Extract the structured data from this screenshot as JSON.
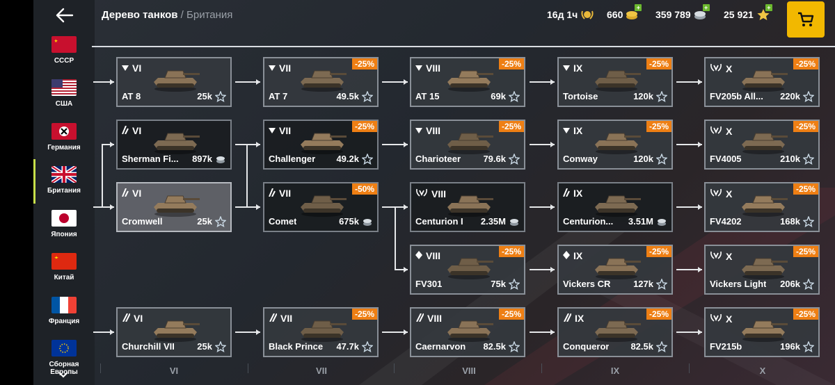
{
  "header": {
    "title": "Дерево танков",
    "separator": " / ",
    "subtitle": "Британия",
    "premium_time": "16д 1ч",
    "gold": "660",
    "credits": "359 789",
    "free_xp": "25 921"
  },
  "nations": [
    {
      "label": "СССР",
      "icon": "ussr-flag-icon"
    },
    {
      "label": "США",
      "icon": "usa-flag-icon"
    },
    {
      "label": "Германия",
      "icon": "germany-flag-icon"
    },
    {
      "label": "Британия",
      "icon": "uk-flag-icon",
      "active": true
    },
    {
      "label": "Япония",
      "icon": "japan-flag-icon"
    },
    {
      "label": "Китай",
      "icon": "china-flag-icon"
    },
    {
      "label": "Франция",
      "icon": "france-flag-icon"
    },
    {
      "label": "Сборная Европы",
      "icon": "europe-flag-icon"
    }
  ],
  "tanks": [
    {
      "tier": "VI",
      "name": "AT 8",
      "price": "25k",
      "currency": "star",
      "type": "td",
      "discount": ""
    },
    {
      "tier": "VII",
      "name": "AT 7",
      "price": "49.5k",
      "currency": "star",
      "type": "td",
      "discount": "-25%"
    },
    {
      "tier": "VIII",
      "name": "AT 15",
      "price": "69k",
      "currency": "star",
      "type": "td",
      "discount": "-25%"
    },
    {
      "tier": "IX",
      "name": "Tortoise",
      "price": "120k",
      "currency": "star",
      "type": "td",
      "discount": "-25%"
    },
    {
      "tier": "X",
      "name": "FV205b All...",
      "price": "220k",
      "currency": "star",
      "type": "elite-td",
      "discount": "-25%"
    },
    {
      "tier": "VI",
      "name": "Sherman Fi...",
      "price": "897k",
      "currency": "credits",
      "type": "medium",
      "discount": ""
    },
    {
      "tier": "VII",
      "name": "Challenger",
      "price": "49.2k",
      "currency": "star",
      "type": "td",
      "discount": "-25%"
    },
    {
      "tier": "VIII",
      "name": "Charioteer",
      "price": "79.6k",
      "currency": "star",
      "type": "td",
      "discount": "-25%"
    },
    {
      "tier": "IX",
      "name": "Conway",
      "price": "120k",
      "currency": "star",
      "type": "td",
      "discount": "-25%"
    },
    {
      "tier": "X",
      "name": "FV4005",
      "price": "210k",
      "currency": "star",
      "type": "elite-td",
      "discount": "-25%"
    },
    {
      "tier": "VI",
      "name": "Cromwell",
      "price": "25k",
      "currency": "star",
      "type": "medium",
      "discount": ""
    },
    {
      "tier": "VII",
      "name": "Comet",
      "price": "675k",
      "currency": "credits",
      "type": "medium",
      "discount": "-50%"
    },
    {
      "tier": "VIII",
      "name": "Centurion I",
      "price": "2.35M",
      "currency": "credits",
      "type": "elite-medium",
      "discount": ""
    },
    {
      "tier": "IX",
      "name": "Centurion...",
      "price": "3.51M",
      "currency": "credits",
      "type": "medium",
      "discount": ""
    },
    {
      "tier": "X",
      "name": "FV4202",
      "price": "168k",
      "currency": "star",
      "type": "elite-medium",
      "discount": "-25%"
    },
    {
      "tier": "VIII",
      "name": "FV301",
      "price": "75k",
      "currency": "star",
      "type": "light",
      "discount": "-25%"
    },
    {
      "tier": "IX",
      "name": "Vickers CR",
      "price": "127k",
      "currency": "star",
      "type": "light",
      "discount": "-25%"
    },
    {
      "tier": "X",
      "name": "Vickers Light",
      "price": "206k",
      "currency": "star",
      "type": "elite-light",
      "discount": "-25%"
    },
    {
      "tier": "VI",
      "name": "Churchill VII",
      "price": "25k",
      "currency": "star",
      "type": "heavy",
      "discount": ""
    },
    {
      "tier": "VII",
      "name": "Black Prince",
      "price": "47.7k",
      "currency": "star",
      "type": "heavy",
      "discount": "-25%"
    },
    {
      "tier": "VIII",
      "name": "Caernarvon",
      "price": "82.5k",
      "currency": "star",
      "type": "heavy",
      "discount": "-25%"
    },
    {
      "tier": "IX",
      "name": "Conqueror",
      "price": "82.5k",
      "currency": "star",
      "type": "heavy",
      "discount": "-25%"
    },
    {
      "tier": "X",
      "name": "FV215b",
      "price": "196k",
      "currency": "star",
      "type": "elite-heavy",
      "discount": "-25%"
    }
  ],
  "tier_labels": [
    "VI",
    "VII",
    "VIII",
    "IX",
    "X"
  ],
  "colors": {
    "discount": "#ee7f14",
    "shop": "#f2b800",
    "active_nation": "#c8e04a"
  }
}
